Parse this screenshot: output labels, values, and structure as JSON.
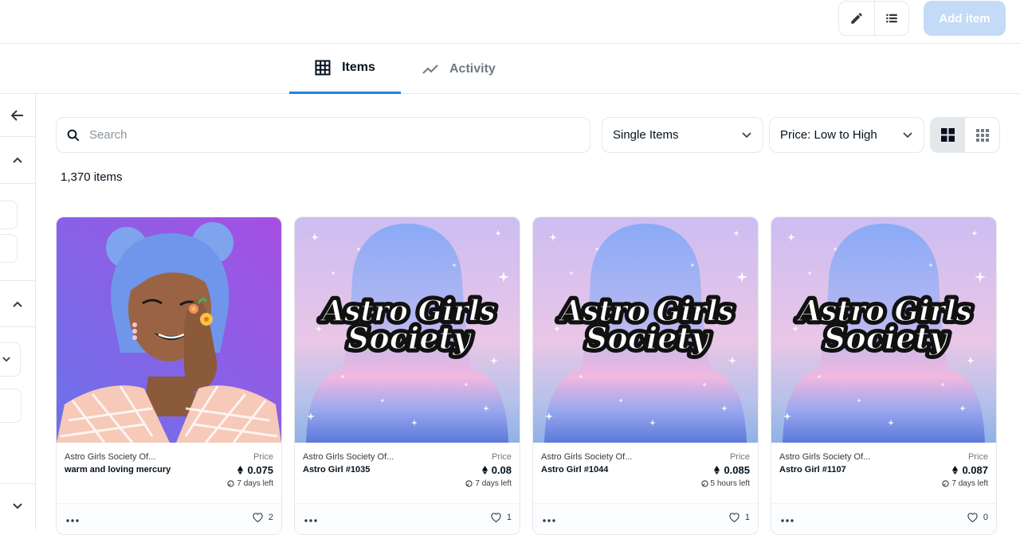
{
  "toolbar": {
    "edit_icon": "pencil-icon",
    "list_icon": "list-icon",
    "add_item_label": "Add item"
  },
  "tabs": [
    {
      "label": "Items",
      "icon": "grid-icon",
      "active": true
    },
    {
      "label": "Activity",
      "icon": "trend-line-icon",
      "active": false
    }
  ],
  "filters": {
    "search_placeholder": "Search",
    "type_select": "Single Items",
    "sort_select": "Price: Low to High",
    "view_mode": "large-grid"
  },
  "results": {
    "count_label": "1,370 items"
  },
  "colors": {
    "accent": "#2081e2",
    "add_item_bg": "#c3dbf7",
    "border": "#e5e8eb"
  },
  "cards": [
    {
      "collection": "Astro Girls Society Of...",
      "name": "warm and loving mercury",
      "price_label": "Price",
      "price": "0.075",
      "time_left": "7 days left",
      "likes": "2",
      "art": "portrait",
      "logo_text_1": "",
      "logo_text_2": ""
    },
    {
      "collection": "Astro Girls Society Of...",
      "name": "Astro Girl #1035",
      "price_label": "Price",
      "price": "0.08",
      "time_left": "7 days left",
      "likes": "1",
      "art": "silhouette",
      "logo_text_1": "Astro Girls",
      "logo_text_2": "Society"
    },
    {
      "collection": "Astro Girls Society Of...",
      "name": "Astro Girl #1044",
      "price_label": "Price",
      "price": "0.085",
      "time_left": "5 hours left",
      "likes": "1",
      "art": "silhouette",
      "logo_text_1": "Astro Girls",
      "logo_text_2": "Society"
    },
    {
      "collection": "Astro Girls Society Of...",
      "name": "Astro Girl #1107",
      "price_label": "Price",
      "price": "0.087",
      "time_left": "7 days left",
      "likes": "0",
      "art": "silhouette",
      "logo_text_1": "Astro Girls",
      "logo_text_2": "Society"
    }
  ]
}
